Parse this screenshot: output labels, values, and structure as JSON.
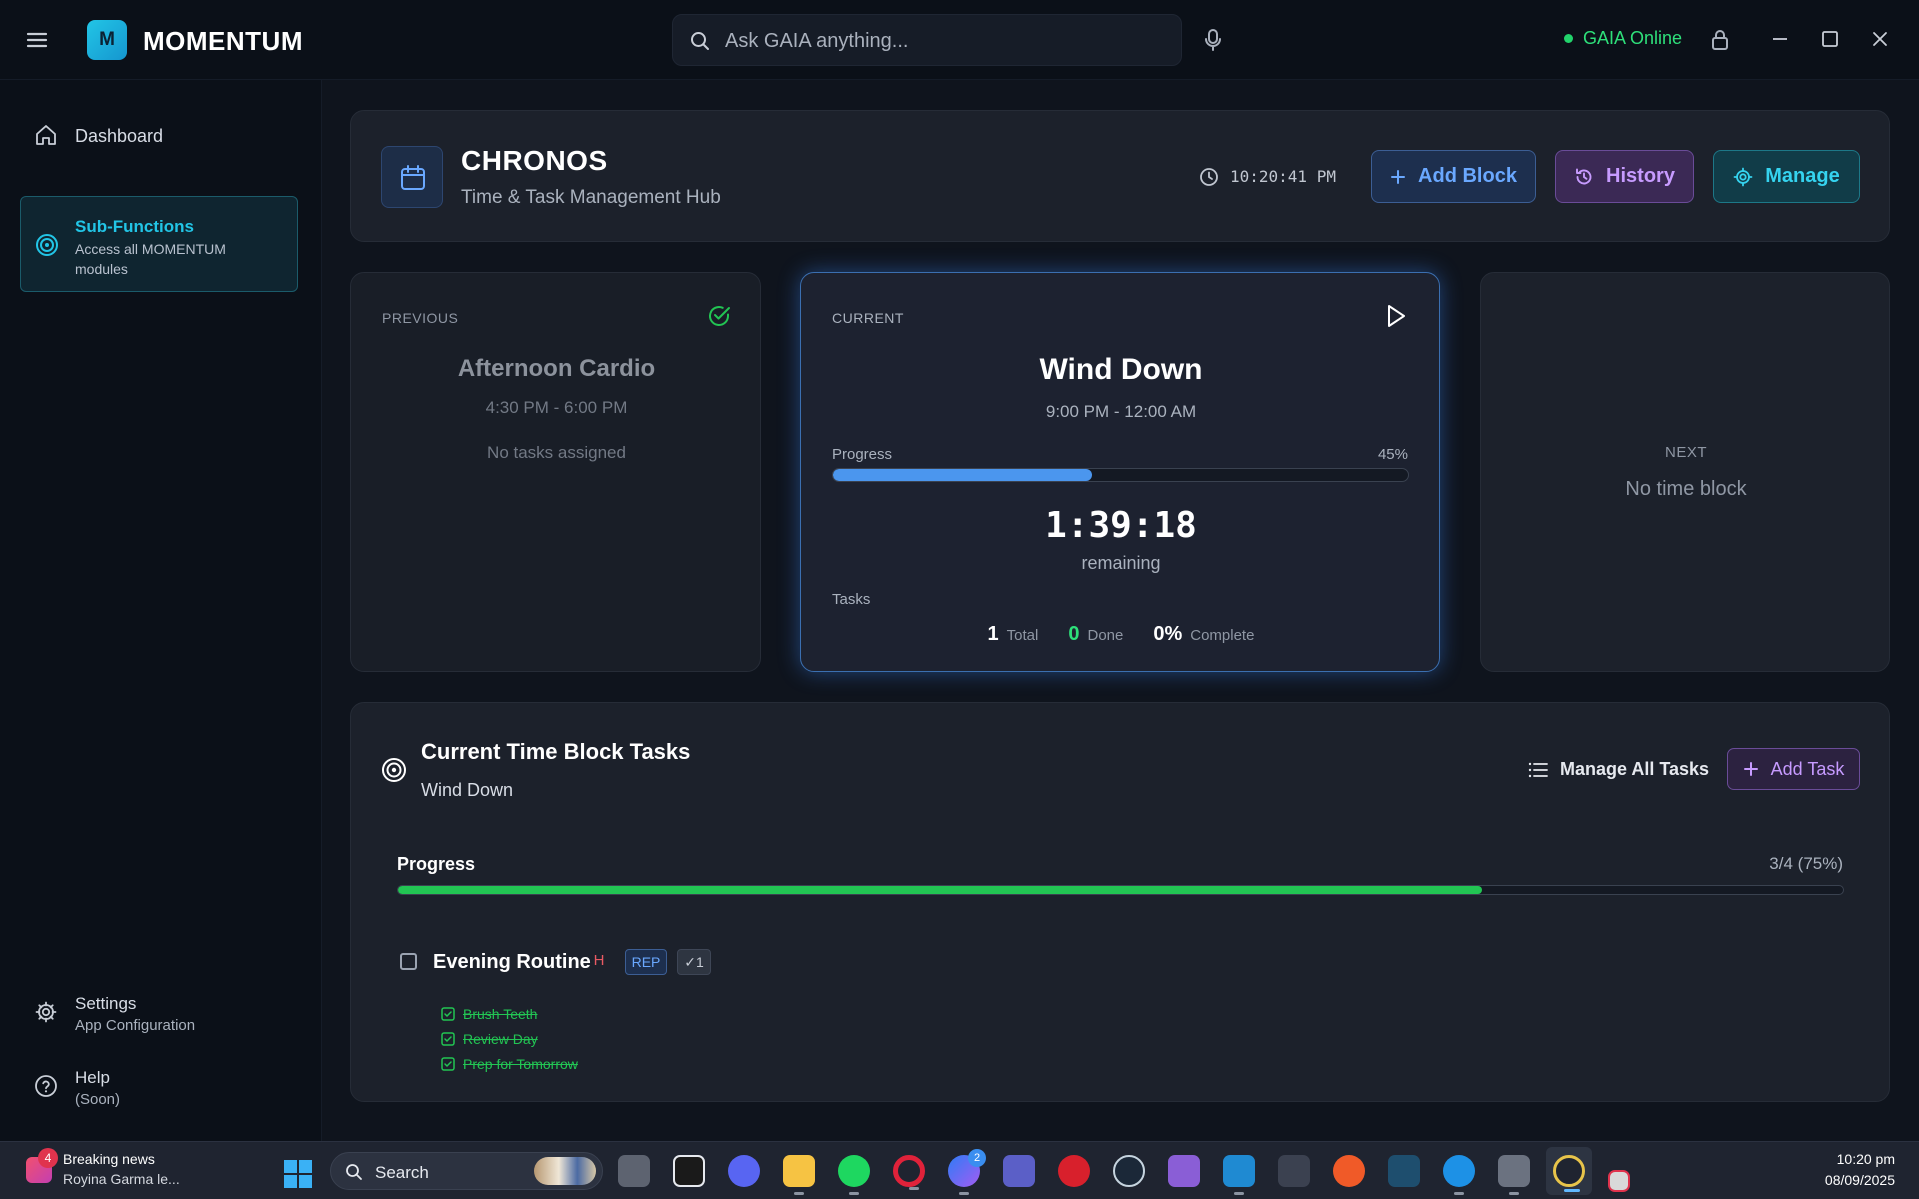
{
  "app": {
    "brand_initial": "M",
    "brand_name": "MOMENTUM",
    "search_placeholder": "Ask GAIA anything...",
    "status_text": "GAIA Online",
    "status_color": "#22d36b",
    "icons": [
      "hamburger-icon",
      "search-icon",
      "microphone-icon",
      "lock-icon",
      "minimize-icon",
      "maximize-icon",
      "close-icon"
    ]
  },
  "sidebar": {
    "dashboard_label": "Dashboard",
    "active": {
      "title": "Sub-Functions",
      "subtitle": "Access all MOMENTUM modules"
    },
    "settings": {
      "title": "Settings",
      "subtitle": "App Configuration"
    },
    "help": {
      "title": "Help",
      "subtitle": "(Soon)"
    }
  },
  "header": {
    "title": "CHRONOS",
    "subtitle": "Time & Task Management Hub",
    "time": "10:20:41 PM",
    "buttons": {
      "add_block": "Add Block",
      "history": "History",
      "manage": "Manage"
    }
  },
  "blocks": {
    "previous": {
      "label": "PREVIOUS",
      "title": "Afternoon Cardio",
      "time": "4:30 PM - 6:00 PM",
      "tasks_text": "No tasks assigned",
      "status_icon": "check-circle-icon"
    },
    "current": {
      "label": "CURRENT",
      "title": "Wind Down",
      "time": "9:00 PM - 12:00 AM",
      "progress_label": "Progress",
      "progress_text": "45%",
      "progress": 0.45,
      "countdown": "1:39:18",
      "remaining_label": "remaining",
      "tasks_label": "Tasks",
      "stats": {
        "total": "1",
        "total_label": "Total",
        "done": "0",
        "done_label": "Done",
        "complete": "0%",
        "complete_label": "Complete"
      },
      "accent": "#4b96ee"
    },
    "next": {
      "label": "NEXT",
      "value": "No time block"
    }
  },
  "tasks": {
    "title": "Current Time Block Tasks",
    "subtitle": "Wind Down",
    "manage_all": "Manage All Tasks",
    "add_task": "Add Task",
    "progress_label": "Progress",
    "progress_text": "3/4 (75%)",
    "progress": 0.75,
    "progress_color": "#22c553",
    "items": [
      {
        "title": "Evening Routine",
        "priority": "H",
        "tag": "REP",
        "count": "✓1",
        "subtasks": [
          "Brush Teeth",
          "Review Day",
          "Prep for Tomorrow"
        ]
      }
    ]
  },
  "taskbar": {
    "news_badge": "4",
    "news_title": "Breaking news",
    "news_sub": "Royina Garma le...",
    "search_label": "Search",
    "messenger_badge": "2",
    "time": "10:20 pm",
    "date": "08/09/2025"
  }
}
